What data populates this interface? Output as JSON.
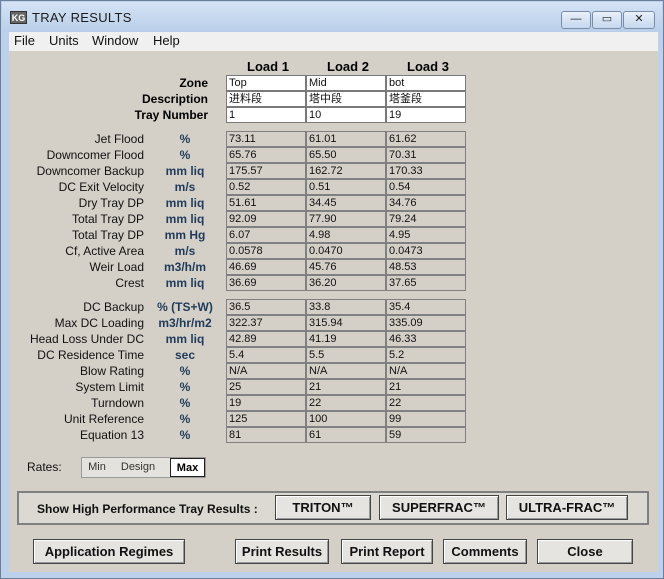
{
  "window": {
    "title": "TRAY RESULTS",
    "icon_text": "KG",
    "minimize": "—",
    "maximize": "▭",
    "close": "✕"
  },
  "menu": [
    "File",
    "Units",
    "Window",
    "Help"
  ],
  "loads": [
    "Load 1",
    "Load 2",
    "Load 3"
  ],
  "input_rows": [
    {
      "label": "Zone",
      "values": [
        "Top",
        "Mid",
        "bot"
      ]
    },
    {
      "label": "Description",
      "values": [
        "进料段",
        "塔中段",
        "塔釜段"
      ]
    },
    {
      "label": "Tray Number",
      "values": [
        "1",
        "10",
        "19"
      ]
    }
  ],
  "results_group1": [
    {
      "label": "Jet Flood",
      "unit": "%",
      "values": [
        "73.11",
        "61.01",
        "61.62"
      ]
    },
    {
      "label": "Downcomer Flood",
      "unit": "%",
      "values": [
        "65.76",
        "65.50",
        "70.31"
      ]
    },
    {
      "label": "Downcomer Backup",
      "unit": "mm liq",
      "values": [
        "175.57",
        "162.72",
        "170.33"
      ]
    },
    {
      "label": "DC Exit Velocity",
      "unit": "m/s",
      "values": [
        "0.52",
        "0.51",
        "0.54"
      ]
    },
    {
      "label": "Dry Tray DP",
      "unit": "mm liq",
      "values": [
        "51.61",
        "34.45",
        "34.76"
      ]
    },
    {
      "label": "Total Tray DP",
      "unit": "mm liq",
      "values": [
        "92.09",
        "77.90",
        "79.24"
      ]
    },
    {
      "label": "Total Tray DP",
      "unit": "mm Hg",
      "values": [
        "6.07",
        "4.98",
        "4.95"
      ]
    },
    {
      "label": "Cf, Active Area",
      "unit": "m/s",
      "values": [
        "0.0578",
        "0.0470",
        "0.0473"
      ]
    },
    {
      "label": "Weir Load",
      "unit": "m3/h/m",
      "values": [
        "46.69",
        "45.76",
        "48.53"
      ]
    },
    {
      "label": "Crest",
      "unit": "mm liq",
      "values": [
        "36.69",
        "36.20",
        "37.65"
      ]
    }
  ],
  "results_group2": [
    {
      "label": "DC Backup",
      "unit": "% (TS+W)",
      "values": [
        "36.5",
        "33.8",
        "35.4"
      ]
    },
    {
      "label": "Max DC Loading",
      "unit": "m3/hr/m2",
      "values": [
        "322.37",
        "315.94",
        "335.09"
      ]
    },
    {
      "label": "Head Loss Under DC",
      "unit": "mm liq",
      "values": [
        "42.89",
        "41.19",
        "46.33"
      ]
    },
    {
      "label": "DC Residence Time",
      "unit": "sec",
      "values": [
        "5.4",
        "5.5",
        "5.2"
      ]
    },
    {
      "label": "Blow Rating",
      "unit": "%",
      "values": [
        "N/A",
        "N/A",
        "N/A"
      ]
    },
    {
      "label": "System Limit",
      "unit": "%",
      "values": [
        "25",
        "21",
        "21"
      ]
    },
    {
      "label": "Turndown",
      "unit": "%",
      "values": [
        "19",
        "22",
        "22"
      ]
    },
    {
      "label": "Unit Reference",
      "unit": "%",
      "values": [
        "125",
        "100",
        "99"
      ]
    },
    {
      "label": "Equation 13",
      "unit": "%",
      "values": [
        "81",
        "61",
        "59"
      ]
    }
  ],
  "rates": {
    "label": "Rates:",
    "options": [
      "Min",
      "Design",
      "Max"
    ],
    "selected": "Max"
  },
  "high_perf": {
    "label": "Show High Performance Tray Results :",
    "buttons": [
      "TRITON™",
      "SUPERFRAC™",
      "ULTRA-FRAC™"
    ]
  },
  "bottom_buttons": {
    "application_regimes": "Application Regimes",
    "print_results": "Print Results",
    "print_report": "Print Report",
    "comments": "Comments",
    "close": "Close"
  }
}
